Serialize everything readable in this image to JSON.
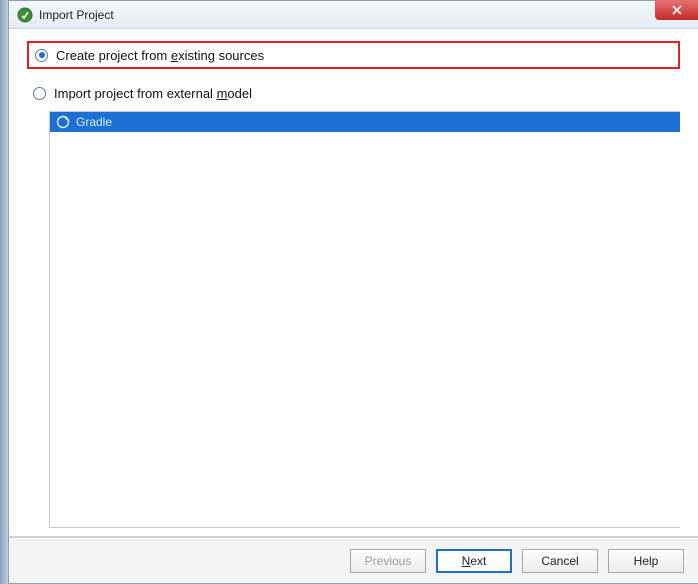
{
  "window": {
    "title": "Import Project"
  },
  "options": {
    "create_from_existing_prefix": "Create project from ",
    "create_from_existing_underline": "e",
    "create_from_existing_suffix": "xisting sources",
    "import_external_prefix": "Import project from external ",
    "import_external_underline": "m",
    "import_external_suffix": "odel"
  },
  "models": {
    "gradle": "Gradle"
  },
  "buttons": {
    "previous": "Previous",
    "next_underline": "N",
    "next_suffix": "ext",
    "cancel": "Cancel",
    "help": "Help"
  }
}
